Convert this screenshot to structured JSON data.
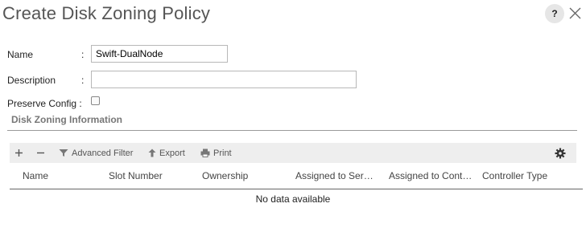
{
  "dialog": {
    "title": "Create Disk Zoning Policy",
    "help_label": "?"
  },
  "form": {
    "colon": ":",
    "name_label": "Name",
    "name_value": "Swift-DualNode",
    "description_label": "Description",
    "description_value": "",
    "preserve_label": "Preserve Config :",
    "preserve_checked": false
  },
  "section": {
    "title": "Disk Zoning Information"
  },
  "toolbar": {
    "advanced_filter_label": "Advanced Filter",
    "export_label": "Export",
    "print_label": "Print",
    "icons": [
      "plus-icon",
      "minus-icon",
      "filter-icon",
      "export-icon",
      "print-icon",
      "gear-icon"
    ]
  },
  "table": {
    "columns": [
      "Name",
      "Slot Number",
      "Ownership",
      "Assigned to Server",
      "Assigned to Controller",
      "Controller Type"
    ],
    "empty_message": "No data available"
  },
  "colors": {
    "toolbar_bg": "#eeeeee",
    "title_text": "#555555",
    "section_text": "#777777"
  }
}
